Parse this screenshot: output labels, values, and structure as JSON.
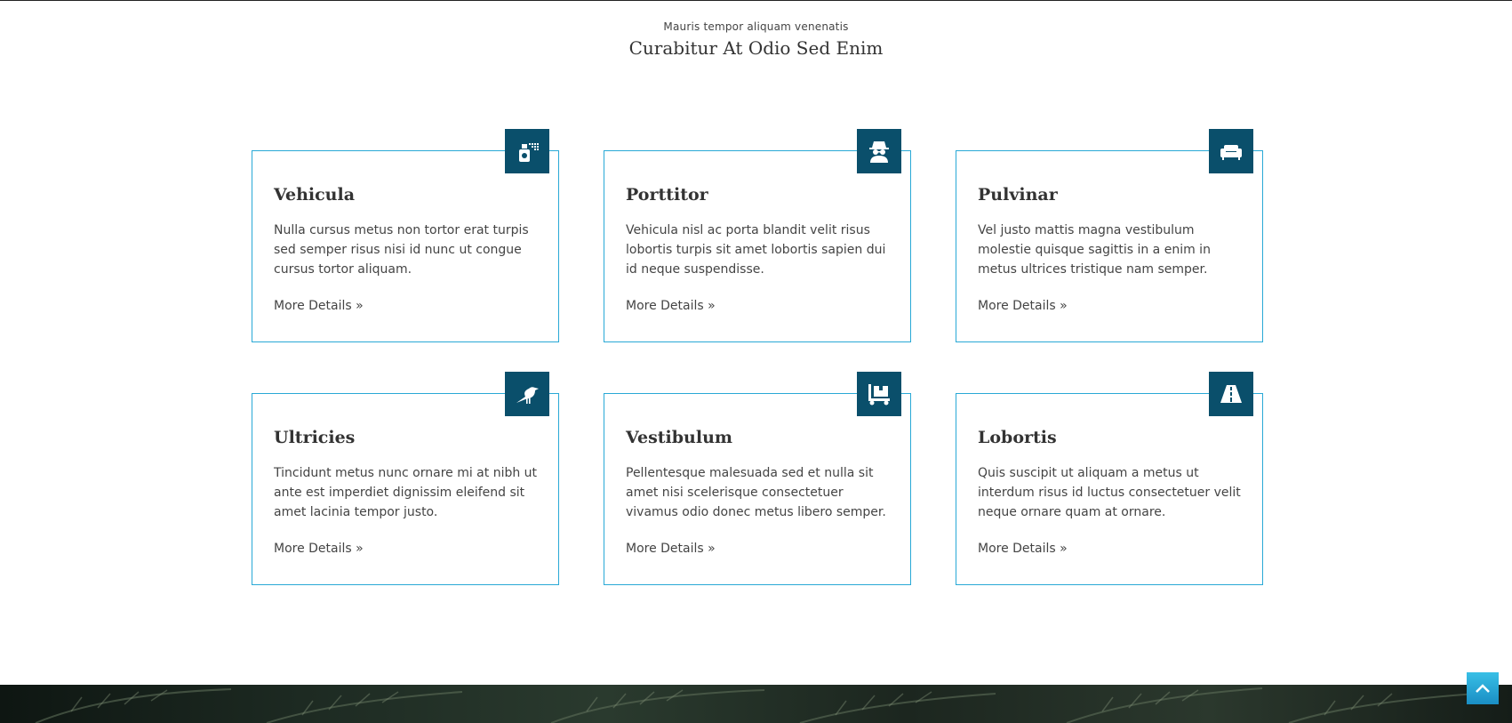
{
  "header": {
    "subtitle": "Mauris tempor aliquam venenatis",
    "title": "Curabitur At Odio Sed Enim"
  },
  "cards": [
    {
      "title": "Vehicula",
      "text": "Nulla cursus metus non tortor erat turpis sed semper risus nisi id nunc ut congue cursus tortor aliquam.",
      "link": "More Details »",
      "icon": "spray-bottle-icon"
    },
    {
      "title": "Porttitor",
      "text": "Vehicula nisl ac porta blandit velit risus lobortis turpis sit amet lobortis sapien dui id neque suspendisse.",
      "link": "More Details »",
      "icon": "spy-icon"
    },
    {
      "title": "Pulvinar",
      "text": "Vel justo mattis magna vestibulum molestie quisque sagittis in a enim in metus ultrices tristique nam semper.",
      "link": "More Details »",
      "icon": "couch-icon"
    },
    {
      "title": "Ultricies",
      "text": "Tincidunt metus nunc ornare mi at nibh ut ante est imperdiet dignissim eleifend sit amet lacinia tempor justo.",
      "link": "More Details »",
      "icon": "crow-icon"
    },
    {
      "title": "Vestibulum",
      "text": "Pellentesque malesuada sed et nulla sit amet nisi scelerisque consectetuer vivamus odio donec metus libero semper.",
      "link": "More Details »",
      "icon": "dolly-icon"
    },
    {
      "title": "Lobortis",
      "text": "Quis suscipit ut aliquam a metus ut interdum risus id luctus consectetuer velit neque ornare quam at ornare.",
      "link": "More Details »",
      "icon": "road-icon"
    }
  ],
  "colors": {
    "accent_border": "#29a9d6",
    "icon_background": "#0a4f6b",
    "back_to_top": "#2aa8d8"
  }
}
